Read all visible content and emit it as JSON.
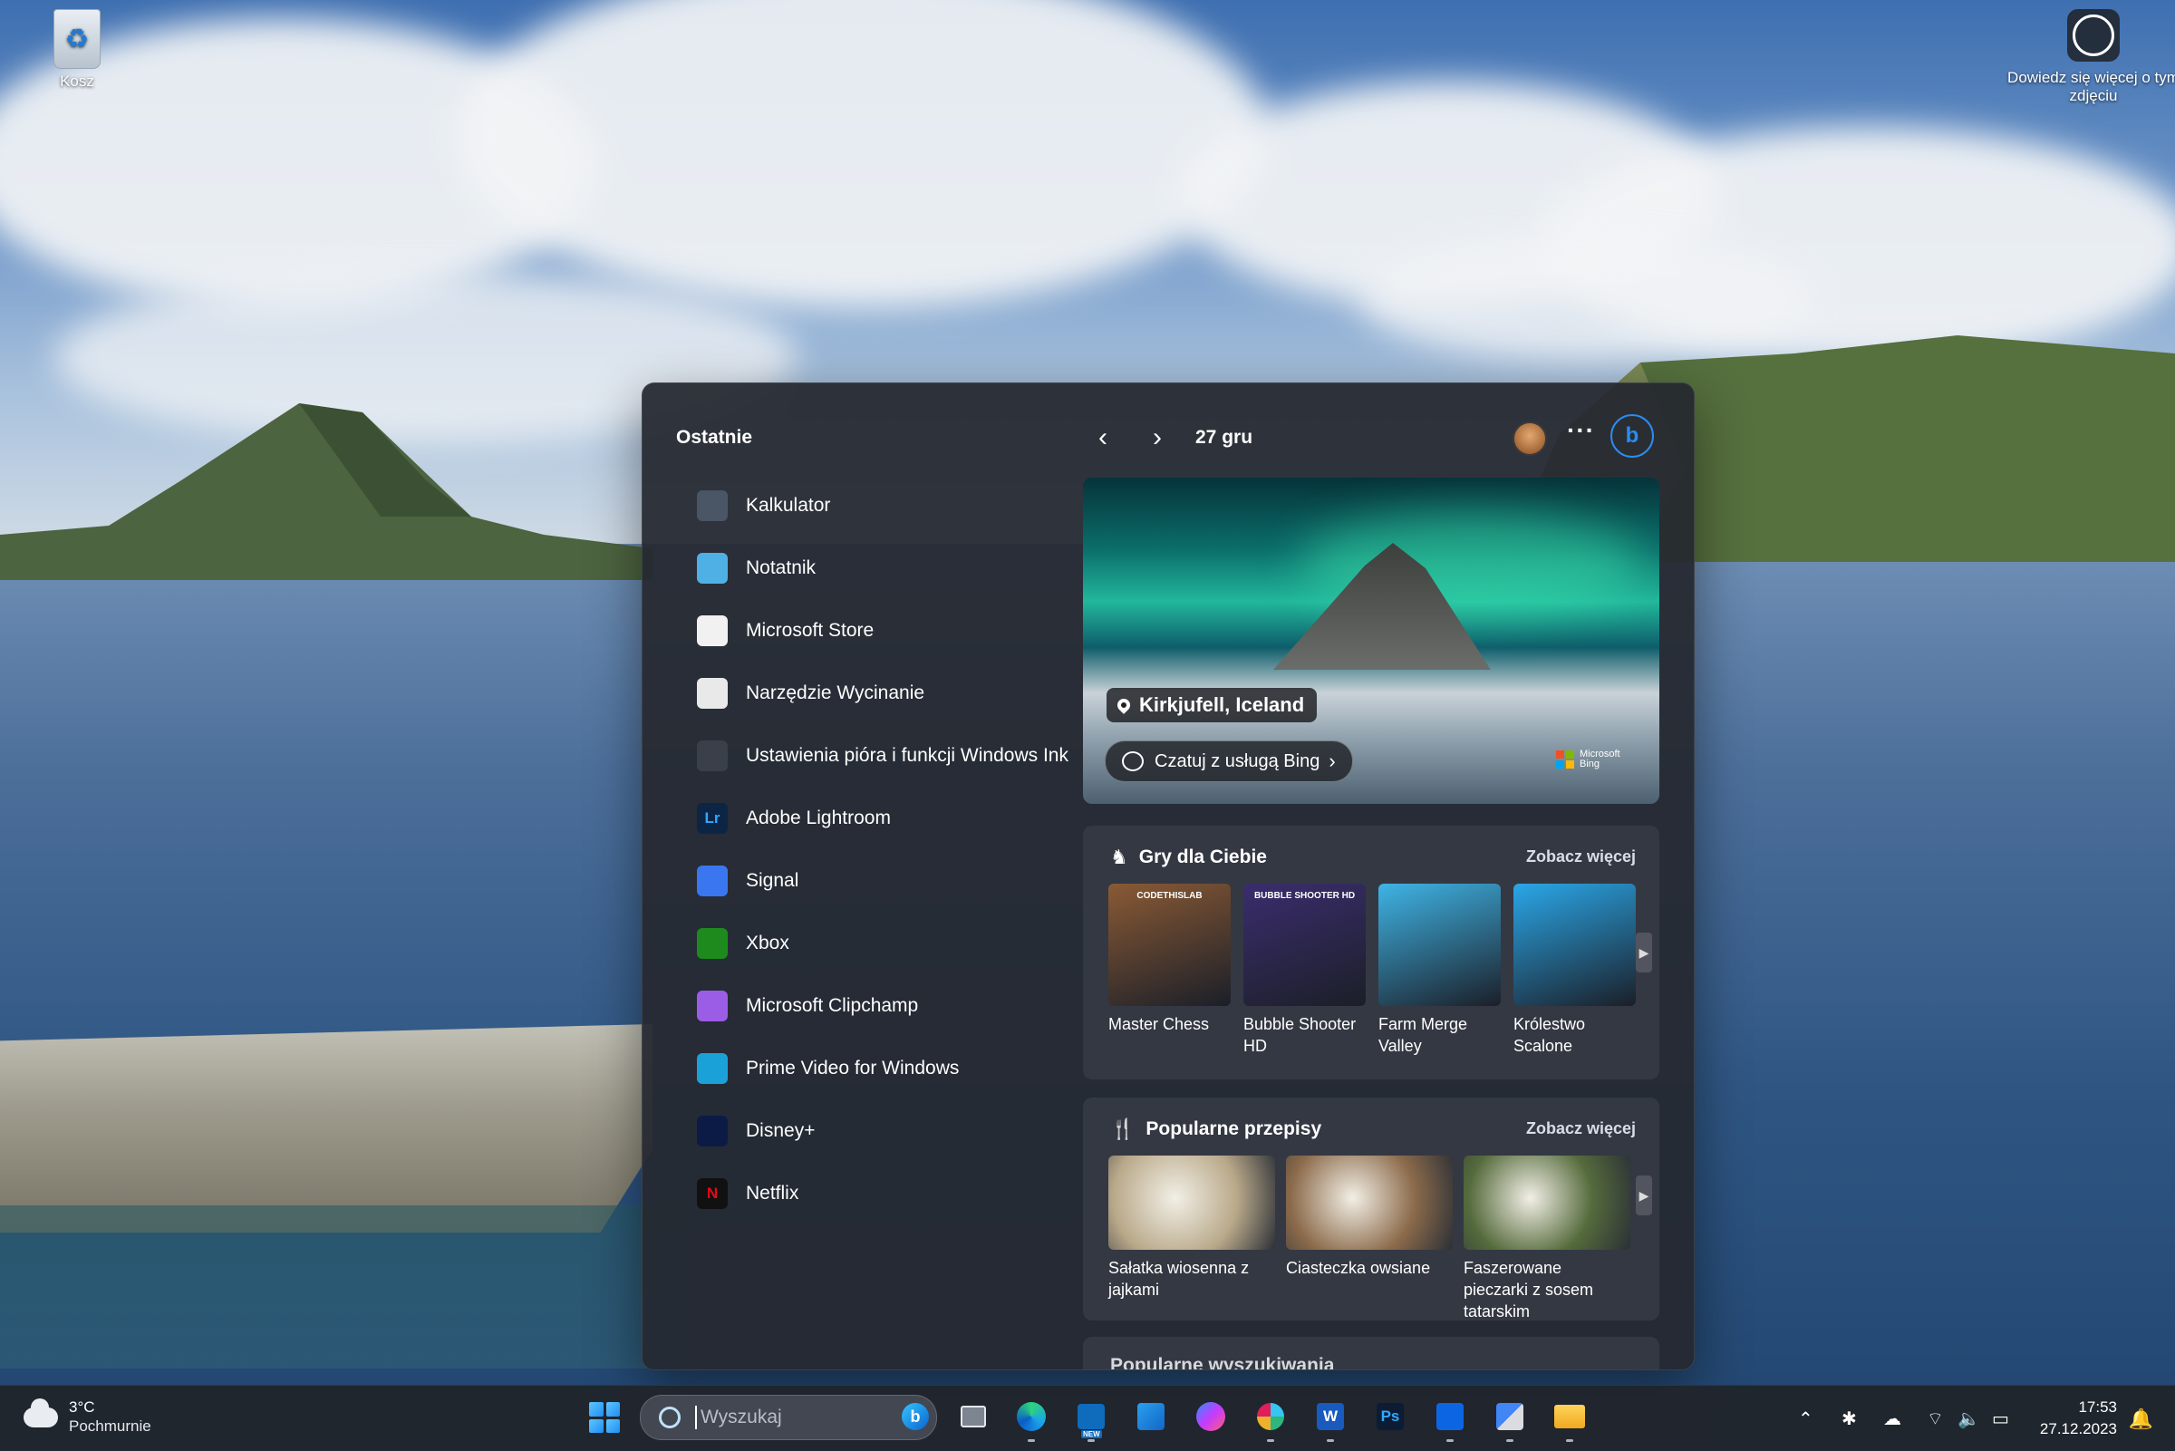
{
  "desktop": {
    "recycle_bin_label": "Kosz",
    "learn_more_label": "Dowiedz się więcej o tym zdjęciu"
  },
  "widgets": {
    "recent_title": "Ostatnie",
    "recent_apps": [
      {
        "label": "Kalkulator",
        "icon": "calculator-icon",
        "color": "#4a5565"
      },
      {
        "label": "Notatnik",
        "icon": "notepad-icon",
        "color": "#4fb0e6"
      },
      {
        "label": "Microsoft Store",
        "icon": "store-icon",
        "color": "#f1f1f1"
      },
      {
        "label": "Narzędzie Wycinanie",
        "icon": "snipping-tool-icon",
        "color": "#e9e9e9"
      },
      {
        "label": "Ustawienia pióra i funkcji Windows Ink",
        "icon": "pen-icon",
        "color": "#3a3f49"
      },
      {
        "label": "Adobe Lightroom",
        "icon": "lightroom-icon",
        "color": "#0d2545",
        "glyph": "Lr"
      },
      {
        "label": "Signal",
        "icon": "signal-icon",
        "color": "#3a76f0"
      },
      {
        "label": "Xbox",
        "icon": "xbox-icon",
        "color": "#1e8a1e"
      },
      {
        "label": "Microsoft Clipchamp",
        "icon": "clipchamp-icon",
        "color": "#9b5ce6"
      },
      {
        "label": "Prime Video for Windows",
        "icon": "prime-video-icon",
        "color": "#1aa2d8"
      },
      {
        "label": "Disney+",
        "icon": "disney-plus-icon",
        "color": "#0c1a46"
      },
      {
        "label": "Netflix",
        "icon": "netflix-icon",
        "color": "#111111",
        "glyph": "N"
      }
    ],
    "date": "27 gru",
    "hero": {
      "location": "Kirkjufell, Iceland",
      "chat_label": "Czatuj z usługą Bing",
      "brand_line1": "Microsoft",
      "brand_line2": "Bing"
    },
    "games": {
      "title": "Gry dla Ciebie",
      "see_more": "Zobacz więcej",
      "items": [
        {
          "label": "Master Chess",
          "color": "#8a5a35",
          "badge": "CODETHISLAB"
        },
        {
          "label": "Bubble Shooter HD",
          "color": "#3b2d6e",
          "badge": "BUBBLE SHOOTER HD"
        },
        {
          "label": "Farm Merge Valley",
          "color": "#3fb4e6"
        },
        {
          "label": "Królestwo Scalone",
          "color": "#2aa7e8"
        }
      ]
    },
    "recipes": {
      "title": "Popularne przepisy",
      "see_more": "Zobacz więcej",
      "items": [
        {
          "label": "Sałatka wiosenna z jajkami",
          "color": "#b9a98a"
        },
        {
          "label": "Ciasteczka owsiane",
          "color": "#8c6b4b"
        },
        {
          "label": "Faszerowane pieczarki z sosem tatarskim",
          "color": "#556b3c"
        }
      ]
    },
    "searches_title": "Popularne wyszukiwania"
  },
  "taskbar": {
    "weather_temp": "3°C",
    "weather_desc": "Pochmurnie",
    "search_placeholder": "Wyszukaj",
    "time": "17:53",
    "date": "27.12.2023",
    "ps_glyph": "Ps",
    "word_glyph": "W",
    "outlook_badge": "NEW"
  }
}
